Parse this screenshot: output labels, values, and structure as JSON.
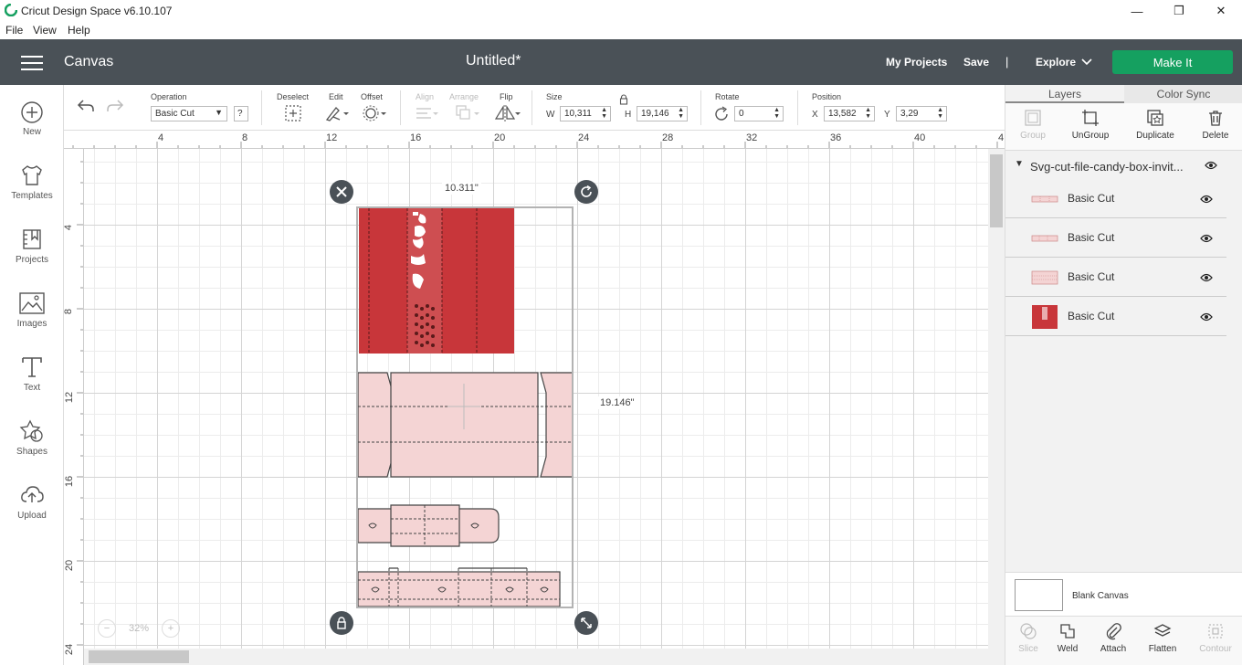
{
  "window": {
    "title": "Cricut Design Space  v6.10.107",
    "minimize": "—",
    "maximize": "❐",
    "close": "✕"
  },
  "menu": [
    "File",
    "View",
    "Help"
  ],
  "header": {
    "section": "Canvas",
    "doc_title": "Untitled*",
    "my_projects": "My Projects",
    "save": "Save",
    "separator": "|",
    "explore": "Explore",
    "make_it": "Make It",
    "colors": {
      "header_bg": "#4a5157",
      "make_it_bg": "#15a060"
    }
  },
  "left_nav": [
    {
      "label": "New",
      "icon": "plus-circle-icon"
    },
    {
      "label": "Templates",
      "icon": "tshirt-icon"
    },
    {
      "label": "Projects",
      "icon": "bookmark-icon"
    },
    {
      "label": "Images",
      "icon": "image-icon"
    },
    {
      "label": "Text",
      "icon": "text-icon"
    },
    {
      "label": "Shapes",
      "icon": "shapes-icon"
    },
    {
      "label": "Upload",
      "icon": "cloud-upload-icon"
    }
  ],
  "toolbar": {
    "operation_label": "Operation",
    "operation_value": "Basic Cut",
    "help": "?",
    "deselect": "Deselect",
    "edit": "Edit",
    "offset": "Offset",
    "align": "Align",
    "arrange": "Arrange",
    "flip": "Flip",
    "size": "Size",
    "w_label": "W",
    "w_value": "10,311",
    "h_label": "H",
    "h_value": "19,146",
    "rotate": "Rotate",
    "rotate_value": "0",
    "position": "Position",
    "x_label": "X",
    "x_value": "13,582",
    "y_label": "Y",
    "y_value": "3,29"
  },
  "ruler_h": [
    "4",
    "8",
    "12",
    "16",
    "20",
    "24",
    "28",
    "32",
    "36",
    "40",
    "4"
  ],
  "ruler_v": [
    "4",
    "8",
    "12",
    "16",
    "20",
    "24"
  ],
  "canvas": {
    "width_label": "10.311\"",
    "height_label": "19.146\"",
    "zoom_minus": "−",
    "zoom_value": "32%",
    "zoom_plus": "+",
    "colors": {
      "red_piece": "#c8363a",
      "pink_piece": "#f4d4d4",
      "outline": "#444444"
    }
  },
  "right_panel": {
    "tabs": [
      "Layers",
      "Color Sync"
    ],
    "tools": [
      "Group",
      "UnGroup",
      "Duplicate",
      "Delete"
    ],
    "group_name": "Svg-cut-file-candy-box-invit...",
    "layers": [
      {
        "name": "Basic Cut",
        "thumb": "pink-strip"
      },
      {
        "name": "Basic Cut",
        "thumb": "pink-strip"
      },
      {
        "name": "Basic Cut",
        "thumb": "pink-box"
      },
      {
        "name": "Basic Cut",
        "thumb": "red-panel"
      }
    ],
    "blank_canvas": "Blank Canvas",
    "bottom_tools": [
      "Slice",
      "Weld",
      "Attach",
      "Flatten",
      "Contour"
    ]
  }
}
